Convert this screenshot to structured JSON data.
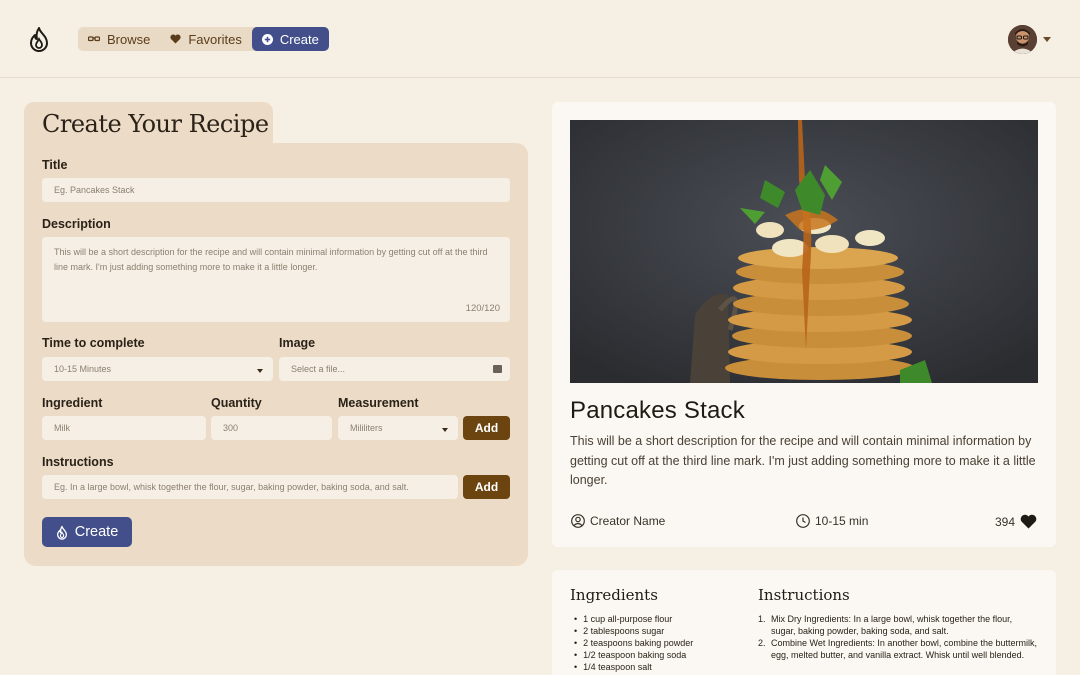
{
  "nav": {
    "items": [
      {
        "label": "Browse",
        "icon": "glasses-icon",
        "active": false
      },
      {
        "label": "Favorites",
        "icon": "heart-icon",
        "active": false
      },
      {
        "label": "Create",
        "icon": "plus-circle-icon",
        "active": true
      }
    ]
  },
  "form": {
    "heading": "Create Your Recipe",
    "title_label": "Title",
    "title_placeholder": "Eg. Pancakes Stack",
    "description_label": "Description",
    "description_placeholder": "This will be a short description for the recipe and will contain minimal information by getting cut off at the third line mark. I'm just adding something more to make it a little longer.",
    "description_counter": "120/120",
    "time_label": "Time to complete",
    "time_value": "10-15 Minutes",
    "image_label": "Image",
    "image_placeholder": "Select a file...",
    "ingredient_label": "Ingredient",
    "ingredient_placeholder": "Milk",
    "quantity_label": "Quantity",
    "quantity_placeholder": "300",
    "measurement_label": "Measurement",
    "measurement_value": "Mililiters",
    "add_label": "Add",
    "instructions_label": "Instructions",
    "instructions_placeholder": "Eg. In a large bowl, whisk together the flour, sugar, baking powder, baking soda, and salt.",
    "create_label": "Create"
  },
  "preview": {
    "title": "Pancakes Stack",
    "description": "This will be a short description for the recipe and will contain minimal information by getting cut off at the third line mark. I'm just adding something more to make it a little longer.",
    "creator": "Creator Name",
    "time": "10-15 min",
    "likes": "394"
  },
  "details": {
    "ingredients_title": "Ingredients",
    "ingredients": [
      "1 cup all-purpose flour",
      "2 tablespoons sugar",
      "2 teaspoons baking powder",
      "1/2 teaspoon baking soda",
      "1/4 teaspoon salt"
    ],
    "instructions_title": "Instructions",
    "instructions": [
      {
        "num": "1.",
        "text": "Mix Dry Ingredients: In a large bowl, whisk together the flour, sugar, baking powder, baking soda, and salt."
      },
      {
        "num": "2.",
        "text": "Combine Wet Ingredients: In another bowl, combine the buttermilk, egg, melted butter, and vanilla extract. Whisk until well blended."
      }
    ]
  },
  "colors": {
    "accent": "#434f8a",
    "brown": "#6b4410",
    "card": "#ecdcc7",
    "background": "#f5efe4"
  }
}
